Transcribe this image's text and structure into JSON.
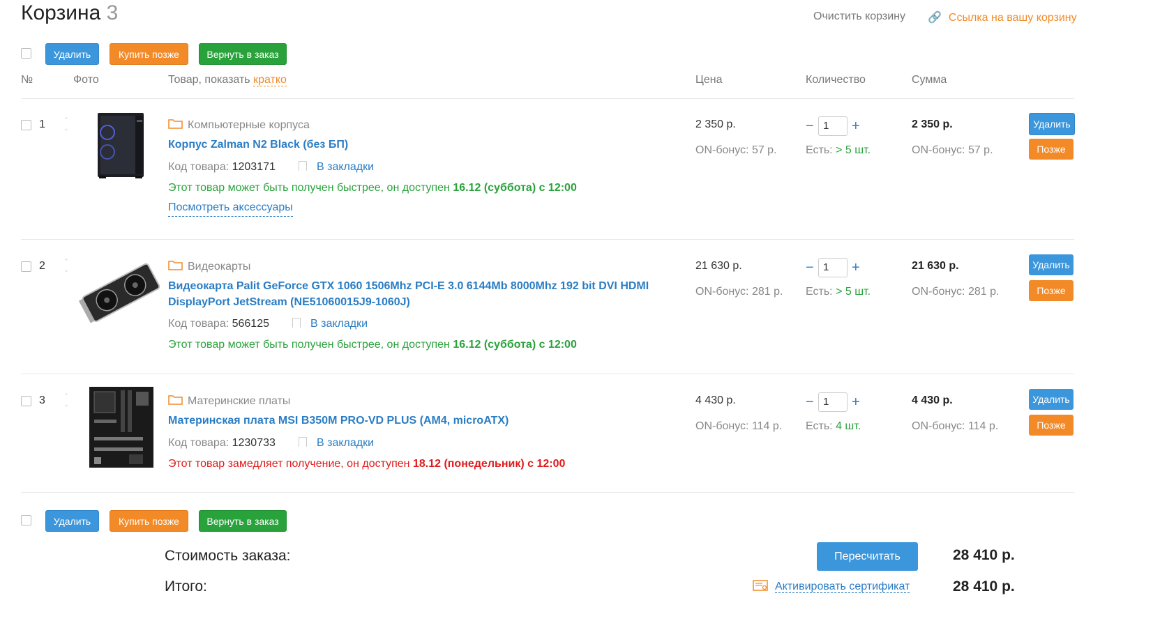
{
  "page": {
    "title": "Корзина",
    "count": "3"
  },
  "top_links": {
    "clear": "Очистить корзину",
    "share": "Ссылка на вашу корзину"
  },
  "actions": {
    "delete": "Удалить",
    "buy_later": "Купить позже",
    "return": "Вернуть в заказ"
  },
  "table": {
    "col_num": "№",
    "col_photo": "Фото",
    "col_item": "Товар, показать",
    "col_item_link": "кратко",
    "col_price": "Цена",
    "col_qty": "Количество",
    "col_sum": "Сумма"
  },
  "labels": {
    "code": "Код товара:",
    "bookmark": "В закладки",
    "accessories": "Посмотреть аксессуары",
    "stock_prefix": "Есть:",
    "row_delete": "Удалить",
    "row_later": "Позже"
  },
  "items": [
    {
      "num": "1",
      "category": "Компьютерные корпуса",
      "title": "Корпус Zalman N2 Black (без БП)",
      "code": "1203171",
      "avail_text": "Этот товар может быть получен быстрее, он доступен",
      "avail_date": "16.12 (суббота) с 12:00",
      "price": "2 350 р.",
      "bonus": "ON-бонус: 57 р.",
      "qty": "1",
      "stock": "> 5 шт.",
      "sum": "2 350 р.",
      "sum_bonus": "ON-бонус: 57 р."
    },
    {
      "num": "2",
      "category": "Видеокарты",
      "title_line1": "Видеокарта Palit GeForce GTX 1060 1506Mhz PCI-E 3.0 6144Mb 8000Mhz 192 bit DVI HDMI",
      "title_line2": "DisplayPort JetStream (NE51060015J9-1060J)",
      "code": "566125",
      "avail_text": "Этот товар может быть получен быстрее, он доступен",
      "avail_date": "16.12 (суббота) с 12:00",
      "price": "21 630 р.",
      "bonus": "ON-бонус: 281 р.",
      "qty": "1",
      "stock": "> 5 шт.",
      "sum": "21 630 р.",
      "sum_bonus": "ON-бонус: 281 р."
    },
    {
      "num": "3",
      "category": "Материнские платы",
      "title": "Материнская плата MSI B350M PRO-VD PLUS (AM4, microATX)",
      "code": "1230733",
      "avail_text": "Этот товар замедляет получение, он доступен",
      "avail_date": "18.12 (понедельник) с 12:00",
      "price": "4 430 р.",
      "bonus": "ON-бонус: 114 р.",
      "qty": "1",
      "stock": "4 шт.",
      "sum": "4 430 р.",
      "sum_bonus": "ON-бонус: 114 р."
    }
  ],
  "summary": {
    "order_cost_label": "Стоимость заказа:",
    "recalc": "Пересчитать",
    "order_cost": "28 410 р.",
    "total_label": "Итого:",
    "certificate": "Активировать сертификат",
    "total": "28 410 р."
  },
  "colors": {
    "link": "#2a7dc4",
    "orange": "#f28a28",
    "green": "#2aa23c",
    "red": "#e01a1a",
    "blue_btn": "#3c96dc"
  }
}
